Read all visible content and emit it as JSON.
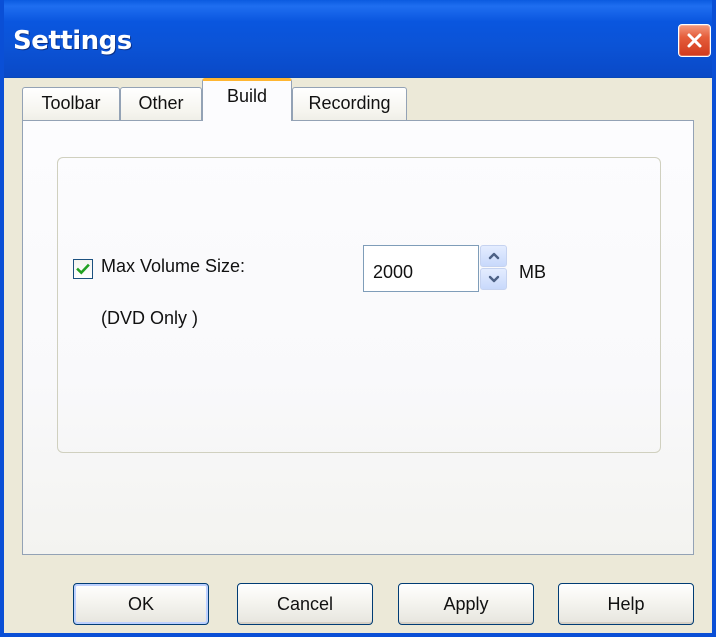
{
  "window": {
    "title": "Settings"
  },
  "tabs": [
    {
      "label": "Toolbar",
      "selected": false
    },
    {
      "label": "Other",
      "selected": false
    },
    {
      "label": "Build",
      "selected": true
    },
    {
      "label": "Recording",
      "selected": false
    }
  ],
  "build": {
    "max_volume_checkbox": {
      "label": "Max Volume Size:",
      "checked": true
    },
    "max_volume_value": "2000",
    "unit": "MB",
    "note": "(DVD Only )"
  },
  "buttons": {
    "ok": "OK",
    "cancel": "Cancel",
    "apply": "Apply",
    "help": "Help"
  },
  "icons": {
    "close": "close-icon",
    "check": "checkmark-icon",
    "spin_up": "arrow-up-icon",
    "spin_down": "arrow-down-icon"
  },
  "colors": {
    "title_bar": "#0a56df",
    "window_background": "#ece9d8",
    "tab_highlight": "#ffb632",
    "close_button": "#d9482c",
    "checkmark": "#21a121"
  }
}
